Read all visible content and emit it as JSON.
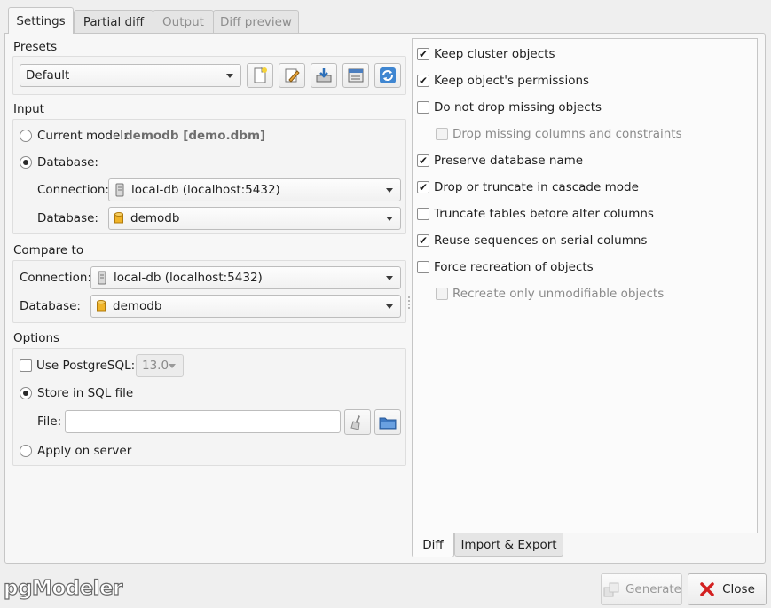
{
  "tabs": [
    "Settings",
    "Partial diff",
    "Output",
    "Diff preview"
  ],
  "presets": {
    "title": "Presets",
    "selected": "Default"
  },
  "input": {
    "title": "Input",
    "current_model_label": "Current model:",
    "current_model_value": "demodb [demo.dbm]",
    "database_radio_label": "Database:",
    "connection_label": "Connection:",
    "connection_value": "local-db (localhost:5432)",
    "database_label": "Database:",
    "database_value": "demodb"
  },
  "compare": {
    "title": "Compare to",
    "connection_label": "Connection:",
    "connection_value": "local-db (localhost:5432)",
    "database_label": "Database:",
    "database_value": "demodb"
  },
  "options": {
    "title": "Options",
    "use_pg_label": "Use PostgreSQL:",
    "pg_version": "13.0",
    "store_sql_label": "Store in SQL file",
    "file_label": "File:",
    "file_value": "",
    "apply_server_label": "Apply on server"
  },
  "diff_options": [
    {
      "label": "Keep cluster objects",
      "checked": true,
      "disabled": false,
      "indent": false
    },
    {
      "label": "Keep object's permissions",
      "checked": true,
      "disabled": false,
      "indent": false
    },
    {
      "label": "Do not drop missing objects",
      "checked": false,
      "disabled": false,
      "indent": false
    },
    {
      "label": "Drop missing columns and constraints",
      "checked": false,
      "disabled": true,
      "indent": true
    },
    {
      "label": "Preserve database name",
      "checked": true,
      "disabled": false,
      "indent": false
    },
    {
      "label": "Drop or truncate in cascade mode",
      "checked": true,
      "disabled": false,
      "indent": false
    },
    {
      "label": "Truncate tables before alter columns",
      "checked": false,
      "disabled": false,
      "indent": false
    },
    {
      "label": "Reuse sequences on serial columns",
      "checked": true,
      "disabled": false,
      "indent": false
    },
    {
      "label": "Force recreation of objects",
      "checked": false,
      "disabled": false,
      "indent": false
    },
    {
      "label": "Recreate only unmodifiable objects",
      "checked": false,
      "disabled": true,
      "indent": true
    }
  ],
  "bottom_tabs": [
    "Diff",
    "Import & Export"
  ],
  "brand": "pgModeler",
  "buttons": {
    "generate": "Generate",
    "close": "Close"
  },
  "colors": {
    "close_x": "#d32020",
    "folder": "#3f79c2",
    "db_cylinder": "#f0b429"
  }
}
